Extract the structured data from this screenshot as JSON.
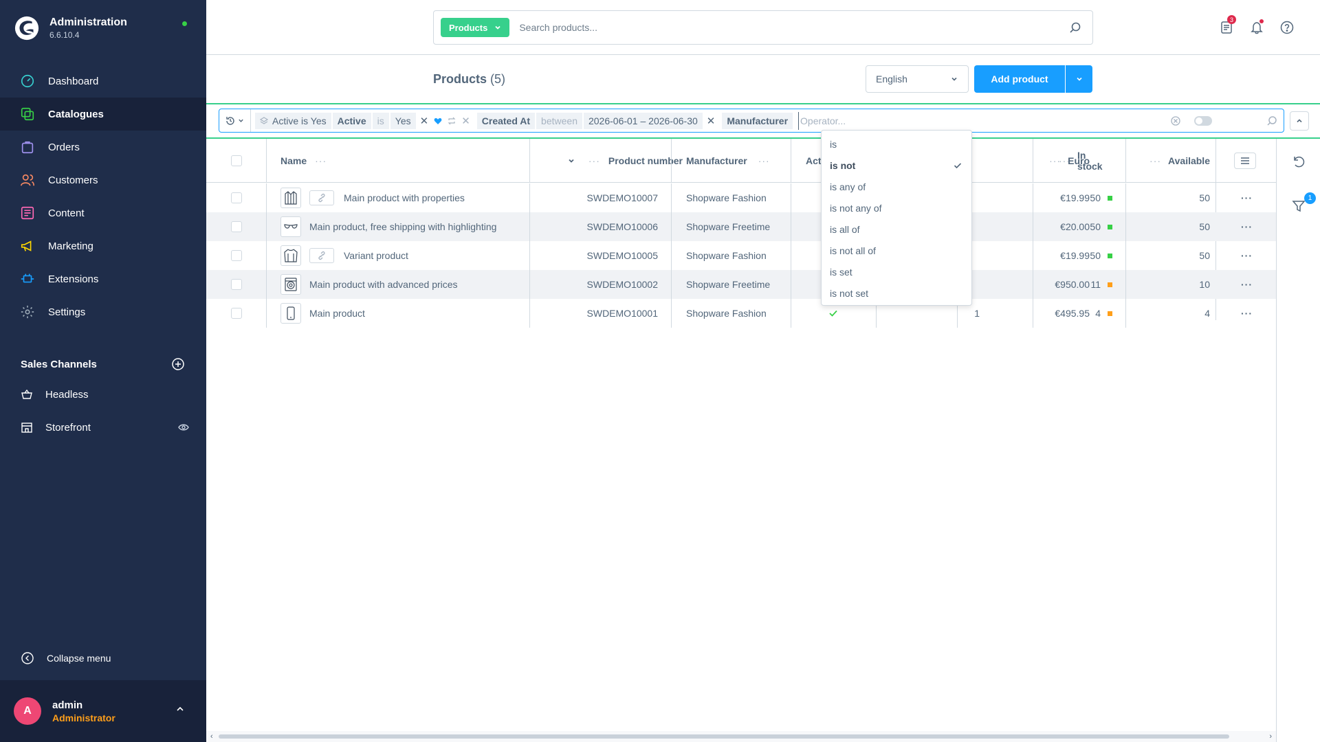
{
  "app": {
    "title": "Administration",
    "version": "6.6.10.4"
  },
  "nav": [
    {
      "label": "Dashboard",
      "icon": "gauge-icon",
      "color": "#37d0d0"
    },
    {
      "label": "Catalogues",
      "icon": "catalogue-icon",
      "color": "#37d046"
    },
    {
      "label": "Orders",
      "icon": "bag-icon",
      "color": "#a092f0"
    },
    {
      "label": "Customers",
      "icon": "users-icon",
      "color": "#f88962"
    },
    {
      "label": "Content",
      "icon": "content-icon",
      "color": "#ff68b4"
    },
    {
      "label": "Marketing",
      "icon": "megaphone-icon",
      "color": "#ffd700"
    },
    {
      "label": "Extensions",
      "icon": "plug-icon",
      "color": "#189eff"
    },
    {
      "label": "Settings",
      "icon": "gear-icon",
      "color": "#9aa8b5"
    }
  ],
  "sales_channels": {
    "title": "Sales Channels",
    "items": [
      {
        "label": "Headless",
        "icon": "basket-icon"
      },
      {
        "label": "Storefront",
        "icon": "store-icon"
      }
    ]
  },
  "collapse_label": "Collapse menu",
  "user": {
    "initial": "A",
    "name": "admin",
    "role": "Administrator"
  },
  "search": {
    "type_label": "Products",
    "placeholder": "Search products..."
  },
  "notifications": {
    "count": "3"
  },
  "page": {
    "title": "Products",
    "count": "(5)",
    "language": "English",
    "add_label": "Add product"
  },
  "filter": {
    "saved_chip_label": "Active is Yes",
    "chip1": {
      "field": "Active",
      "op": "is",
      "value": "Yes"
    },
    "chip2": {
      "field": "Created At",
      "op": "between",
      "value": "2026-06-01 – 2026-06-30"
    },
    "chip3": {
      "field": "Manufacturer"
    },
    "input_placeholder": "Operator..."
  },
  "columns": {
    "name": "Name",
    "product_number": "Product number",
    "manufacturer": "Manufacturer",
    "active": "Act",
    "euro": "Euro",
    "in_stock": "In stock",
    "available": "Available"
  },
  "rows": [
    {
      "name": "Main product with properties",
      "number": "SWDEMO10007",
      "manufacturer": "Shopware Fashion",
      "euro": "€19.99",
      "stock": "50",
      "available": "50",
      "stock_color": "#37d046",
      "variant": true,
      "thumb_icon": "jacket-icon"
    },
    {
      "name": "Main product, free shipping with highlighting",
      "number": "SWDEMO10006",
      "manufacturer": "Shopware Freetime",
      "euro": "€20.00",
      "stock": "50",
      "available": "50",
      "stock_color": "#37d046",
      "variant": false,
      "thumb_icon": "sunglasses-icon"
    },
    {
      "name": "Variant product",
      "number": "SWDEMO10005",
      "manufacturer": "Shopware Fashion",
      "euro": "€19.99",
      "stock": "50",
      "available": "50",
      "stock_color": "#37d046",
      "variant": true,
      "thumb_icon": "sweater-icon"
    },
    {
      "name": "Main product with advanced prices",
      "number": "SWDEMO10002",
      "manufacturer": "Shopware Freetime",
      "euro": "€950.00",
      "stock": "11",
      "available": "10",
      "stock_color": "#ff9f1a",
      "variant": false,
      "thumb_icon": "washer-icon"
    },
    {
      "name": "Main product",
      "number": "SWDEMO10001",
      "manufacturer": "Shopware Fashion",
      "euro": "€495.95",
      "stock": "4",
      "available": "4",
      "stock_color": "#ff9f1a",
      "variant": false,
      "thumb_icon": "phone-icon",
      "extra_value": "1"
    }
  ],
  "operator_dropdown": {
    "options": [
      "is",
      "is not",
      "is any of",
      "is not any of",
      "is all of",
      "is not all of",
      "is set",
      "is not set"
    ],
    "selected": "is not"
  },
  "filter_badge": "1"
}
